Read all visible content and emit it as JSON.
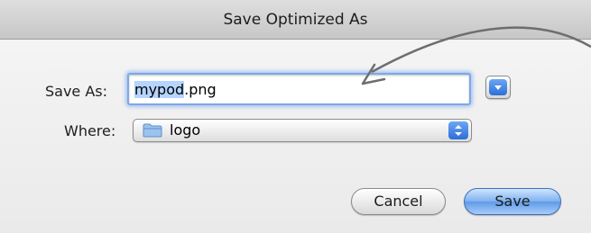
{
  "window": {
    "title": "Save Optimized As"
  },
  "form": {
    "save_as_label": "Save As:",
    "filename_selected": "mypod",
    "filename_rest": ".png",
    "where_label": "Where:",
    "where_value": "logo"
  },
  "buttons": {
    "cancel": "Cancel",
    "save": "Save"
  },
  "icons": {
    "disclosure": "chevron-down-icon",
    "folder": "folder-icon",
    "stepper": "up-down-chevron-icon",
    "annotation": "curved-arrow-icon"
  },
  "colors": {
    "accent_blue": "#2c6fd6",
    "focus_ring": "#7ea8e6",
    "selection": "#b5d4ff"
  }
}
